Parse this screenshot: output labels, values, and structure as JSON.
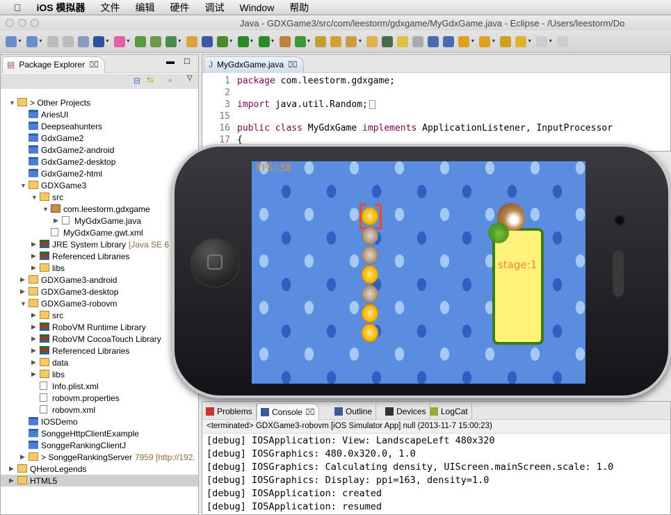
{
  "menubar": {
    "app": "iOS 模拟器",
    "items": [
      "文件",
      "编辑",
      "硬件",
      "调试",
      "Window",
      "帮助"
    ]
  },
  "window": {
    "title": "Java - GDXGame3/src/com/leestorm/gdxgame/MyGdxGame.java - Eclipse - /Users/leestorm/Do"
  },
  "toolbar": {
    "icons": [
      "new-wizard-icon",
      "new-file-icon",
      "save-icon",
      "save-all-icon",
      "print-icon",
      "google-icon",
      "color-wheel-icon",
      "android-sdk-icon",
      "android-avd-icon",
      "task-icon",
      "new-java-icon",
      "skip-breakpoints-icon",
      "debug-icon",
      "run-icon",
      "run-external-icon",
      "new-package-icon",
      "new-class-icon",
      "open-type-icon",
      "open-task-icon",
      "search-icon",
      "open-folder-icon",
      "terminal-icon",
      "highlight-icon",
      "occurrences-icon",
      "block-select-icon",
      "show-whitespace-icon",
      "next-annotation-icon",
      "prev-annotation-icon",
      "last-edit-icon",
      "back-icon",
      "forward-icon",
      "pin-icon"
    ]
  },
  "package_explorer": {
    "title": "Package Explorer",
    "items": [
      {
        "label": "> Other Projects",
        "depth": 0,
        "icon": "working-set",
        "expanded": true
      },
      {
        "label": "AriesUI",
        "depth": 1,
        "icon": "closed-project"
      },
      {
        "label": "Deepseahunters",
        "depth": 1,
        "icon": "closed-project"
      },
      {
        "label": "GdxGame2",
        "depth": 1,
        "icon": "closed-project"
      },
      {
        "label": "GdxGame2-android",
        "depth": 1,
        "icon": "closed-project"
      },
      {
        "label": "GdxGame2-desktop",
        "depth": 1,
        "icon": "closed-project"
      },
      {
        "label": "GdxGame2-html",
        "depth": 1,
        "icon": "closed-project"
      },
      {
        "label": "GDXGame3",
        "depth": 1,
        "icon": "java-project",
        "expanded": true
      },
      {
        "label": "src",
        "depth": 2,
        "icon": "source-folder",
        "expanded": true
      },
      {
        "label": "com.leestorm.gdxgame",
        "depth": 3,
        "icon": "package",
        "expanded": true
      },
      {
        "label": "MyGdxGame.java",
        "depth": 4,
        "icon": "java-file",
        "collapsed": true
      },
      {
        "label": "MyGdxGame.gwt.xml",
        "depth": 3,
        "icon": "xml-file"
      },
      {
        "label": "JRE System Library",
        "suffix": "[Java SE 6 (Ma",
        "depth": 2,
        "icon": "library",
        "collapsed": true
      },
      {
        "label": "Referenced Libraries",
        "depth": 2,
        "icon": "library",
        "collapsed": true
      },
      {
        "label": "libs",
        "depth": 2,
        "icon": "folder",
        "collapsed": true
      },
      {
        "label": "GDXGame3-android",
        "depth": 1,
        "icon": "java-project",
        "collapsed": true
      },
      {
        "label": "GDXGame3-desktop",
        "depth": 1,
        "icon": "java-project",
        "collapsed": true
      },
      {
        "label": "GDXGame3-robovm",
        "depth": 1,
        "icon": "java-project",
        "expanded": true
      },
      {
        "label": "src",
        "depth": 2,
        "icon": "source-folder",
        "collapsed": true
      },
      {
        "label": "RoboVM Runtime Library",
        "depth": 2,
        "icon": "library",
        "collapsed": true
      },
      {
        "label": "RoboVM CocoaTouch Library",
        "depth": 2,
        "icon": "library",
        "collapsed": true
      },
      {
        "label": "Referenced Libraries",
        "depth": 2,
        "icon": "library",
        "collapsed": true
      },
      {
        "label": "data",
        "depth": 2,
        "icon": "folder",
        "collapsed": true
      },
      {
        "label": "libs",
        "depth": 2,
        "icon": "folder",
        "collapsed": true
      },
      {
        "label": "Info.plist.xml",
        "depth": 2,
        "icon": "xml-file"
      },
      {
        "label": "robovm.properties",
        "depth": 2,
        "icon": "text-file"
      },
      {
        "label": "robovm.xml",
        "depth": 2,
        "icon": "xml-file"
      },
      {
        "label": "IOSDemo",
        "depth": 1,
        "icon": "closed-project"
      },
      {
        "label": "SonggeHttpClientExample",
        "depth": 1,
        "icon": "closed-project"
      },
      {
        "label": "SonggeRankingClientJ",
        "depth": 1,
        "icon": "closed-project"
      },
      {
        "label": "> SonggeRankingServer",
        "suffix": "7959 [http://192.",
        "depth": 1,
        "icon": "java-project",
        "collapsed": true
      },
      {
        "label": "QHeroLegends",
        "depth": 0,
        "icon": "working-set",
        "collapsed": true
      },
      {
        "label": "HTML5",
        "depth": 0,
        "icon": "working-set",
        "collapsed": true,
        "selected": true
      }
    ]
  },
  "editor": {
    "tab": "MyGdxGame.java",
    "lines": [
      {
        "n": "1",
        "kw": "package",
        "rest": " com.leestorm.gdxgame;"
      },
      {
        "n": "2",
        "kw": "",
        "rest": ""
      },
      {
        "n": "3",
        "kw": "import",
        "rest": " java.util.Random;"
      },
      {
        "n": "15",
        "kw": "",
        "rest": ""
      },
      {
        "n": "16",
        "kw": "public class",
        "rest": " MyGdxGame ",
        "kw2": "implements",
        "rest2": " ApplicationListener, InputProcessor"
      },
      {
        "n": "17",
        "kw": "",
        "rest": "{"
      }
    ]
  },
  "game": {
    "fps": "FPS:38",
    "stage": "stage:1",
    "coins": [
      "gold",
      "stone",
      "stone",
      "gold",
      "stone",
      "gold",
      "gold"
    ]
  },
  "bottom": {
    "tabs": [
      "Problems",
      "Console",
      "Outline",
      "Devices",
      "LogCat"
    ],
    "active": "Console",
    "status": "<terminated> GDXGame3-robovm [iOS Simulator App] null (2013-11-7 15:00:23)",
    "lines": [
      "[debug] IOSApplication: View: LandscapeLeft 480x320",
      "[debug] IOSGraphics: 480.0x320.0, 1.0",
      "[debug] IOSGraphics: Calculating density, UIScreen.mainScreen.scale: 1.0",
      "[debug] IOSGraphics: Display: ppi=163, density=1.0",
      "[debug] IOSApplication: created",
      "[debug] IOSApplication: resumed"
    ]
  }
}
